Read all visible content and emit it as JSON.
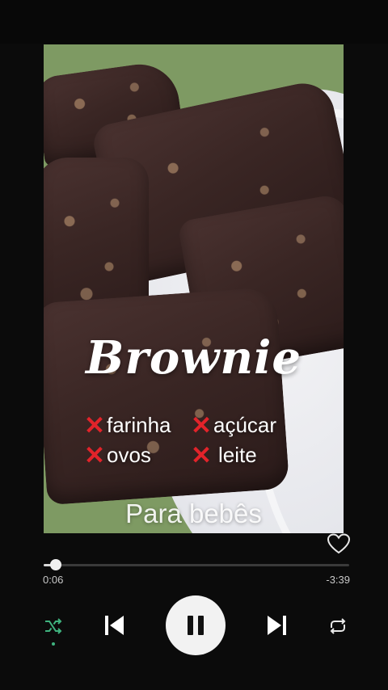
{
  "video": {
    "title": "Brownie",
    "ingredients": [
      {
        "label": "farinha"
      },
      {
        "label": "açúcar"
      },
      {
        "label": "ovos"
      },
      {
        "label": "leite"
      }
    ],
    "subtitle": "Para bebês",
    "cross_icon": "cross-mark-icon",
    "cross_glyph": "✕",
    "cross_color": "#e2232a"
  },
  "player": {
    "elapsed": "0:06",
    "remaining": "-3:39",
    "progress_fraction": 0.04,
    "like_icon": "heart-icon",
    "controls": [
      "shuffle-icon",
      "previous-icon",
      "pause-icon",
      "next-icon",
      "repeat-icon"
    ],
    "shuffle_active_color": "#3fb37f"
  }
}
